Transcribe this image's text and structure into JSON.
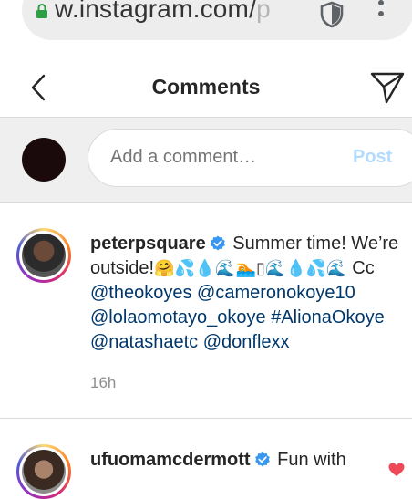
{
  "browser": {
    "url_main": "w.instagram.com/",
    "url_faded_left": "",
    "url_faded_right": "p"
  },
  "header": {
    "title": "Comments"
  },
  "composer": {
    "placeholder": "Add a comment…",
    "post_label": "Post"
  },
  "comments": [
    {
      "username": "peterpsquare",
      "text": "Summer time! We’re outside!",
      "emojis": "🤗💦💧🌊🏊▯🌊💧💦🌊",
      "cc_prefix": "Cc",
      "mentions": [
        "@theokoyes",
        "@cameronokoye10",
        "@lolaomotayo_okoye",
        "#AlionaOkoye",
        "@natashaetc",
        "@donflexx"
      ],
      "timestamp": "16h"
    },
    {
      "username": "ufuomamcdermott",
      "text": "Fun with"
    }
  ],
  "colors": {
    "link": "#00376b",
    "post_disabled": "#b3dbff",
    "verified": "#3897f0",
    "heart": "#ed4956"
  },
  "icons": {
    "lock": "lock-icon",
    "shield": "shield-icon",
    "menu": "kebab-menu-icon",
    "back": "chevron-left-icon",
    "send": "paper-plane-icon",
    "verified": "verified-badge-icon",
    "like": "heart-icon"
  }
}
